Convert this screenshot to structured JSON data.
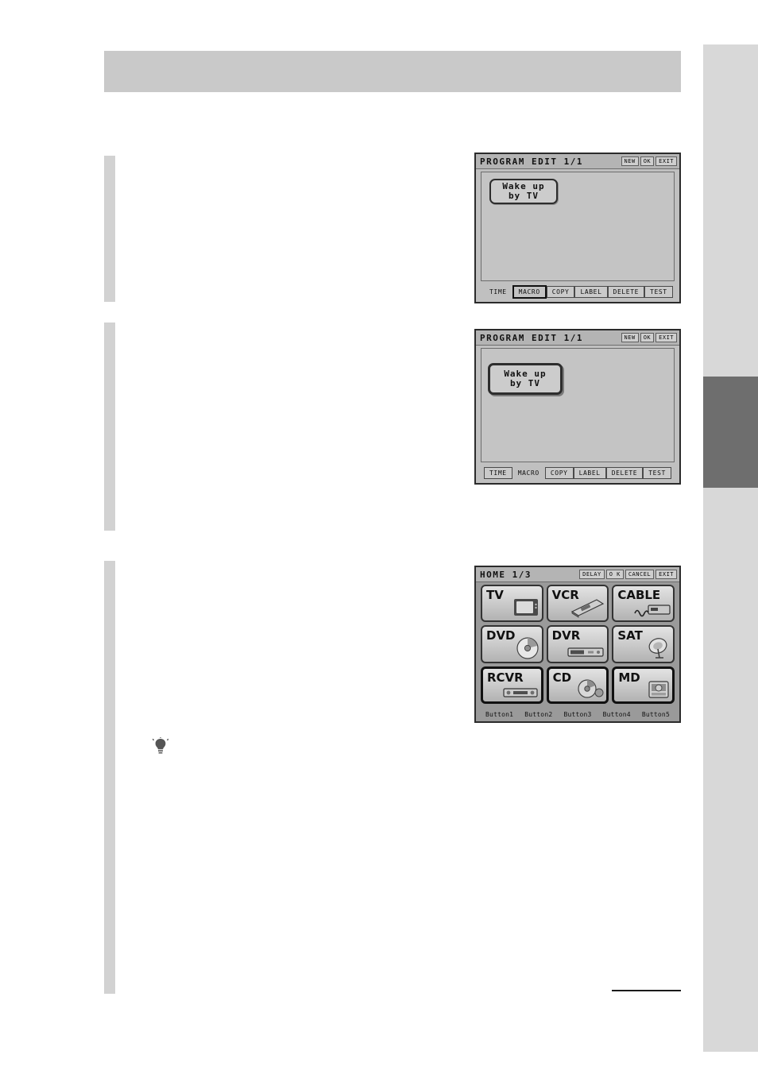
{
  "document": {
    "page_background": "#ffffff",
    "header_band_color": "#c9c9c9",
    "side_tab_color": "#d8d8d8",
    "side_tab_highlight_color": "#6e6e6e",
    "tip_icon": "lightbulb-icon"
  },
  "screens": [
    {
      "id": "program-edit-1",
      "title": "PROGRAM EDIT 1/1",
      "title_buttons": [
        "NEW",
        "OK",
        "EXIT"
      ],
      "macro_buttons": [
        {
          "line1": "Wake up",
          "line2": "by TV",
          "selected": false
        }
      ],
      "soft_keys": [
        {
          "label": "TIME",
          "boxed": false,
          "active": false
        },
        {
          "label": "MACRO",
          "boxed": true,
          "active": true
        },
        {
          "label": "COPY",
          "boxed": true,
          "active": false
        },
        {
          "label": "LABEL",
          "boxed": true,
          "active": false
        },
        {
          "label": "DELETE",
          "boxed": true,
          "active": false
        },
        {
          "label": "TEST",
          "boxed": true,
          "active": false
        }
      ]
    },
    {
      "id": "program-edit-2",
      "title": "PROGRAM EDIT 1/1",
      "title_buttons": [
        "NEW",
        "OK",
        "EXIT"
      ],
      "macro_buttons": [
        {
          "line1": "Wake up",
          "line2": "by TV",
          "selected": true
        }
      ],
      "soft_keys": [
        {
          "label": "TIME",
          "boxed": true,
          "active": false
        },
        {
          "label": "MACRO",
          "boxed": false,
          "active": false
        },
        {
          "label": "COPY",
          "boxed": true,
          "active": false
        },
        {
          "label": "LABEL",
          "boxed": true,
          "active": false
        },
        {
          "label": "DELETE",
          "boxed": true,
          "active": false
        },
        {
          "label": "TEST",
          "boxed": true,
          "active": false
        }
      ]
    }
  ],
  "home_screen": {
    "id": "home-screen",
    "title": "HOME 1/3",
    "title_buttons": [
      "DELAY",
      "O K",
      "CANCEL",
      "EXIT"
    ],
    "devices": [
      {
        "label": "TV",
        "icon": "television-icon",
        "selected": false
      },
      {
        "label": "VCR",
        "icon": "vcr-icon",
        "selected": false
      },
      {
        "label": "CABLE",
        "icon": "cable-box-icon",
        "selected": false
      },
      {
        "label": "DVD",
        "icon": "dvd-disc-icon",
        "selected": false
      },
      {
        "label": "DVR",
        "icon": "dvr-deck-icon",
        "selected": false
      },
      {
        "label": "SAT",
        "icon": "satellite-dish-icon",
        "selected": false
      },
      {
        "label": "RCVR",
        "icon": "receiver-icon",
        "selected": true
      },
      {
        "label": "CD",
        "icon": "compact-disc-icon",
        "selected": true
      },
      {
        "label": "MD",
        "icon": "minidisc-icon",
        "selected": true
      }
    ],
    "footer_labels": [
      "Button1",
      "Button2",
      "Button3",
      "Button4",
      "Button5"
    ]
  }
}
